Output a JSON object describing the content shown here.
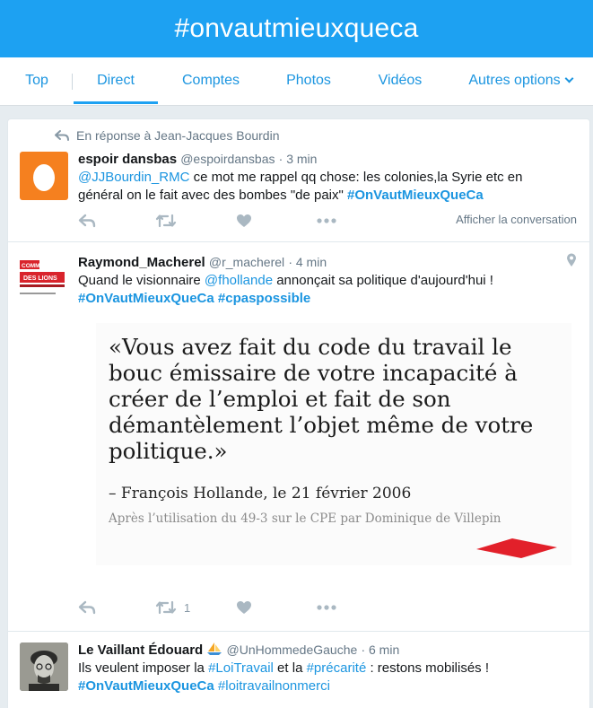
{
  "header": {
    "title": "#onvautmieuxqueca"
  },
  "tabs": [
    {
      "label": "Top"
    },
    {
      "label": "Direct"
    },
    {
      "label": "Comptes"
    },
    {
      "label": "Photos"
    },
    {
      "label": "Vidéos"
    },
    {
      "label": "Autres options"
    }
  ],
  "tweets": [
    {
      "reply_context": "En réponse à Jean-Jacques Bourdin",
      "name": "espoir dansbas",
      "handle": "@espoirdansbas",
      "time": "· 3 min",
      "mention": "@JJBourdin_RMC",
      "text1": " ce mot me rappel qq chose: les colonies,la Syrie etc en général on le fait avec des bombes \"de paix\" ",
      "hashtag1": "#OnVautMieuxQueCa",
      "show_conversation": "Afficher la conversation",
      "avatar_icon": "egg-icon",
      "avatar_color": "#f5801f"
    },
    {
      "name": "Raymond_Macherel",
      "handle": "@r_macherel",
      "time": "· 4 min",
      "text1": "Quand le visionnaire ",
      "mention": "@fhollande",
      "text2": " annonçait sa politique d'aujourd'hui !",
      "hashtag1": "#OnVautMieuxQueCa",
      "hashtag2": "#cpaspossible",
      "retweet_count": "1",
      "avatar": {
        "line1": "COMME",
        "line2": "DES LIONS"
      },
      "image": {
        "quote": "«Vous avez fait du code du travail le bouc émissaire de votre incapacité à créer de l’emploi et fait de son démantèlement l’objet même de votre politique.»",
        "author": "– François Hollande, le 21 février 2006",
        "note": "Après l’utilisation du 49-3 sur le CPE par Dominique de Villepin"
      }
    },
    {
      "name": "Le Vaillant Édouard",
      "handle": "@UnHommedeGauche",
      "time": "· 6 min",
      "text1": "Ils veulent imposer la ",
      "hashtag_a": "#LoiTravail",
      "text2": " et la ",
      "hashtag_b": "#précarité",
      "text3": " : restons mobilisés !",
      "hashtag1": "#OnVautMieuxQueCa",
      "hashtag2": "#loitravailnonmerci"
    }
  ],
  "colors": {
    "accent": "#1da1f2",
    "link": "#1b95e0",
    "muted": "#657786"
  }
}
